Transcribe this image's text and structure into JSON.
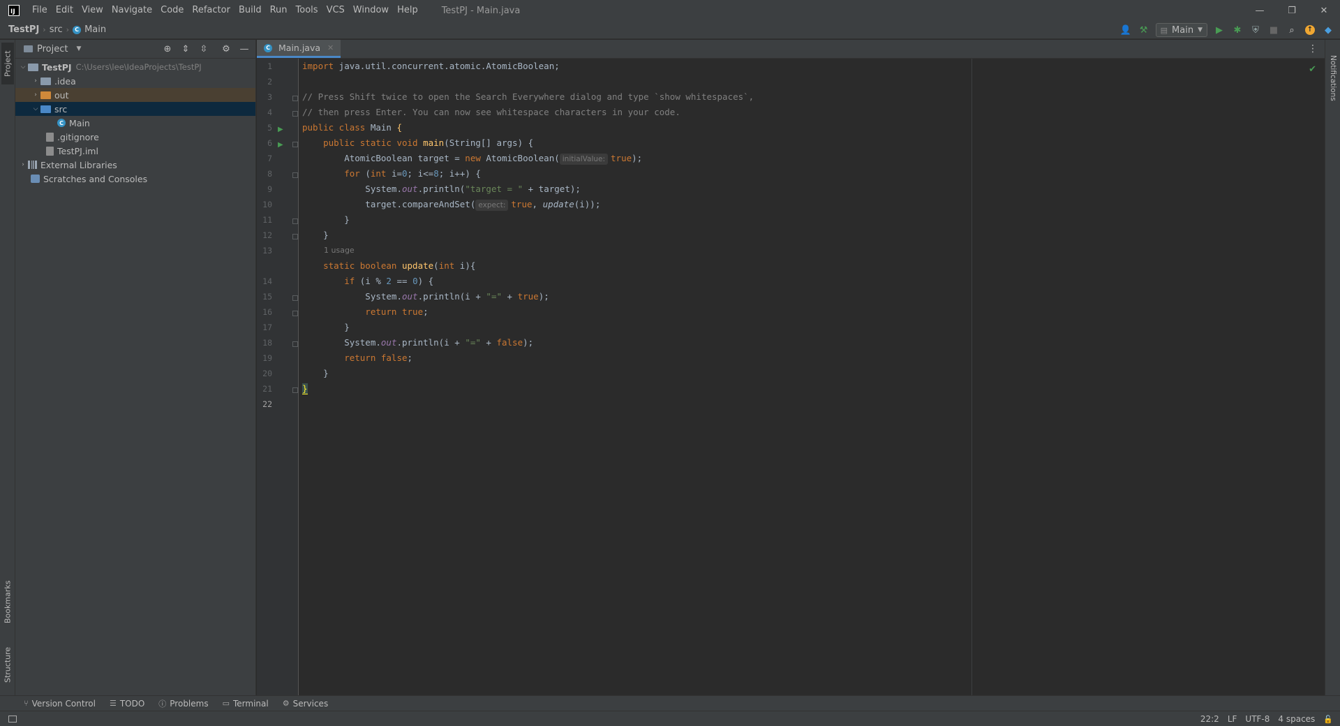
{
  "app": {
    "logo_text": "IJ",
    "window_title": "TestPJ - Main.java",
    "menu": [
      "File",
      "Edit",
      "View",
      "Navigate",
      "Code",
      "Refactor",
      "Build",
      "Run",
      "Tools",
      "VCS",
      "Window",
      "Help"
    ]
  },
  "breadcrumb": {
    "project": "TestPJ",
    "folder": "src",
    "file": "Main"
  },
  "toolbar": {
    "run_config": "Main"
  },
  "left_stripe": {
    "project": "Project",
    "bookmarks": "Bookmarks",
    "structure": "Structure"
  },
  "project_panel": {
    "title": "Project",
    "tree": {
      "root_name": "TestPJ",
      "root_path": "C:\\Users\\lee\\IdeaProjects\\TestPJ",
      "idea": ".idea",
      "out": "out",
      "src": "src",
      "main": "Main",
      "gitignore": ".gitignore",
      "iml": "TestPJ.iml",
      "external_libraries": "External Libraries",
      "scratches": "Scratches and Consoles"
    }
  },
  "editor": {
    "tab_label": "Main.java",
    "usage_hint": "1 usage",
    "line_numbers": [
      "1",
      "2",
      "3",
      "4",
      "5",
      "6",
      "7",
      "8",
      "9",
      "10",
      "11",
      "12",
      "13",
      "14",
      "15",
      "16",
      "17",
      "18",
      "19",
      "20",
      "21",
      "22"
    ],
    "hints": {
      "initial_value": "initialValue:",
      "expect": "expect:"
    },
    "code": {
      "l1_kw": "import",
      "l1_rest": " java.util.concurrent.atomic.AtomicBoolean;",
      "l3": "// Press Shift twice to open the Search Everywhere dialog and type `show whitespaces`,",
      "l4": "// then press Enter. You can now see whitespace characters in your code.",
      "l5_kw": "public class",
      "l5_name": " Main ",
      "l5_brace": "{",
      "l6_kw": "    public static void",
      "l6_fn": " main",
      "l6_rest": "(String[] args) {",
      "l7_a": "        AtomicBoolean target = ",
      "l7_kw": "new",
      "l7_b": " AtomicBoolean(",
      "l7_val": "true",
      "l7_end": ");",
      "l8_kw": "        for",
      "l8_a": " (",
      "l8_int": "int",
      "l8_b": " i=",
      "l8_n0": "0",
      "l8_c": "; i<=",
      "l8_n8": "8",
      "l8_d": "; i++) {",
      "l9_a": "            System.",
      "l9_out": "out",
      "l9_b": ".println(",
      "l9_str": "\"target = \"",
      "l9_c": " + target);",
      "l10_a": "            target.compareAndSet(",
      "l10_true": "true",
      "l10_b": ", ",
      "l10_upd": "update",
      "l10_c": "(i));",
      "l11": "        }",
      "l12": "    }",
      "l14_kw": "    static boolean",
      "l14_fn": " update",
      "l14_a": "(",
      "l14_int": "int",
      "l14_b": " i){",
      "l15_kw": "        if",
      "l15_a": " (i % ",
      "l15_n2": "2",
      "l15_b": " == ",
      "l15_n0": "0",
      "l15_c": ") {",
      "l16_a": "            System.",
      "l16_out": "out",
      "l16_b": ".println(i + ",
      "l16_str": "\"=\"",
      "l16_c": " + ",
      "l16_true": "true",
      "l16_d": ");",
      "l17_kw": "            return true",
      "l17_end": ";",
      "l18": "        }",
      "l19_a": "        System.",
      "l19_out": "out",
      "l19_b": ".println(i + ",
      "l19_str": "\"=\"",
      "l19_c": " + ",
      "l19_false": "false",
      "l19_d": ");",
      "l20_kw": "        return false",
      "l20_end": ";",
      "l21": "    }",
      "l22": "}"
    }
  },
  "right_stripe": {
    "notifications": "Notifications"
  },
  "bottom_tools": [
    "Version Control",
    "TODO",
    "Problems",
    "Terminal",
    "Services"
  ],
  "status": {
    "position": "22:2",
    "line_sep": "LF",
    "encoding": "UTF-8",
    "indent": "4 spaces"
  }
}
